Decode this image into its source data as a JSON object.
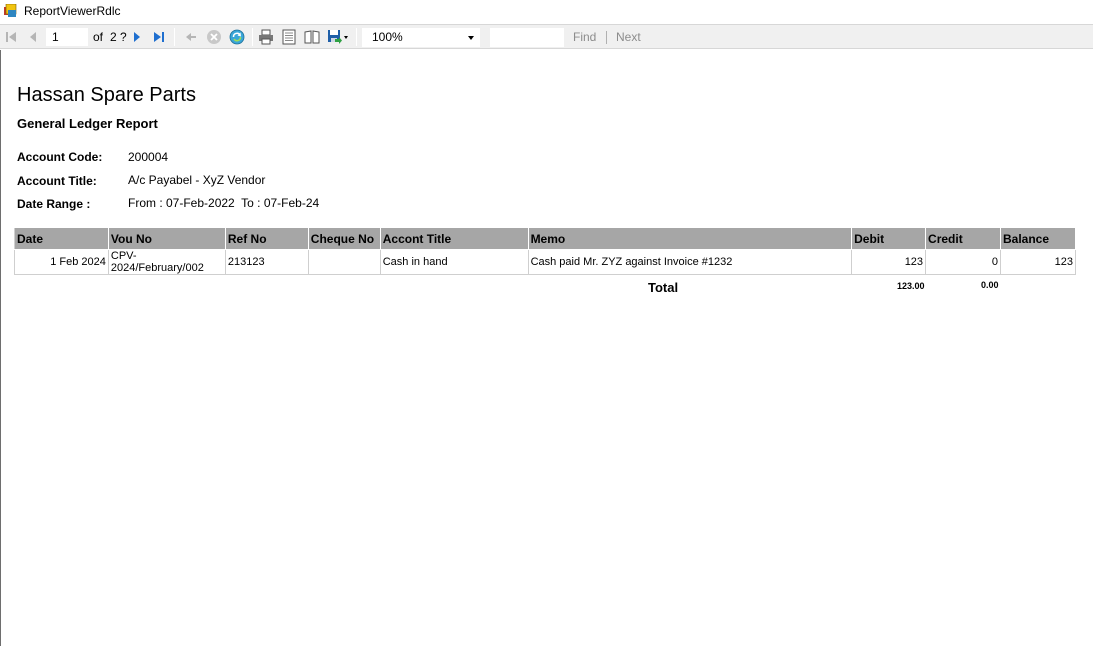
{
  "window": {
    "title": "ReportViewerRdlc"
  },
  "toolbar": {
    "page_current": "1",
    "page_of": "of",
    "page_total": "2 ?",
    "zoom": "100%",
    "find_label": "Find",
    "next_label": "Next",
    "icons": [
      "first-page-icon",
      "previous-page-icon",
      "next-page-icon",
      "last-page-icon",
      "back-icon",
      "stop-icon",
      "refresh-icon",
      "print-icon",
      "print-layout-icon",
      "page-setup-icon",
      "export-icon"
    ]
  },
  "report": {
    "company": "Hassan Spare Parts",
    "title": "General Ledger Report",
    "fields": [
      {
        "label": "Account Code:",
        "value": "200004"
      },
      {
        "label": "Account Title:",
        "value": "A/c Payabel - XyZ Vendor"
      },
      {
        "label": "Date Range :",
        "value": "From : 07-Feb-2022  To : 07-Feb-24"
      }
    ],
    "table": {
      "headers": [
        "Date",
        "Vou No",
        "Ref No",
        "Cheque No",
        "Accont Title",
        "Memo",
        "Debit",
        "Credit",
        "Balance"
      ],
      "rows": [
        [
          "1 Feb 2024",
          "CPV-2024/February/002",
          "213123",
          "",
          "Cash in hand",
          "Cash paid Mr. ZYZ against Invoice #1232",
          "123",
          "0",
          "123"
        ]
      ]
    },
    "total_label": "Total",
    "total_debit": "123.00",
    "total_credit": "0.00"
  }
}
